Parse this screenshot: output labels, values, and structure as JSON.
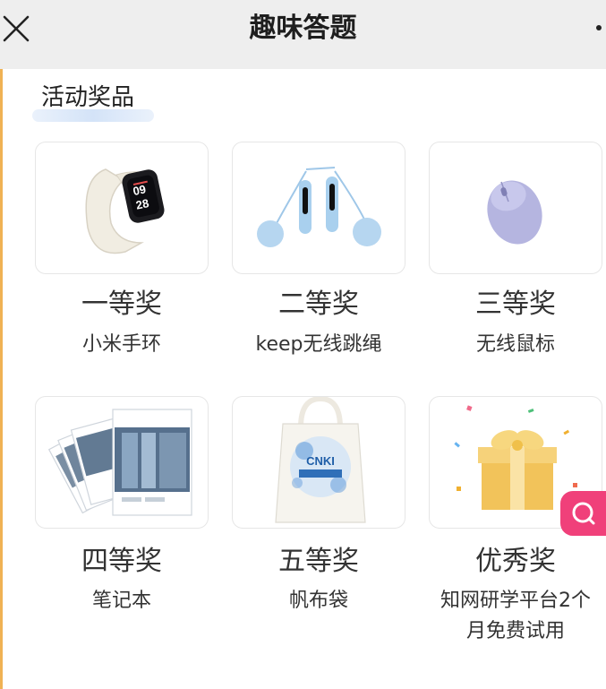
{
  "header": {
    "title": "趣味答题",
    "close_icon": "close-icon",
    "menu_icon": "more-dot-icon"
  },
  "section": {
    "title": "活动奖品"
  },
  "prizes": [
    {
      "rank": "一等奖",
      "name": "小米手环",
      "icon": "fitness-band-image"
    },
    {
      "rank": "二等奖",
      "name": "keep无线跳绳",
      "icon": "jump-rope-image"
    },
    {
      "rank": "三等奖",
      "name": "无线鼠标",
      "icon": "wireless-mouse-image"
    },
    {
      "rank": "四等奖",
      "name": "笔记本",
      "icon": "notebooks-image"
    },
    {
      "rank": "五等奖",
      "name": "帆布袋",
      "icon": "canvas-bag-image",
      "logo_text": "CNKI"
    },
    {
      "rank": "优秀奖",
      "name_line1": "知网研学平台2个",
      "name_line2": "月免费试用",
      "icon": "gift-box-image"
    }
  ],
  "colors": {
    "topbar": "#eeeeee",
    "accent_pink": "#f0407a",
    "left_edge": "#f0b254",
    "text": "#333333"
  },
  "floating_action": {
    "icon": "search-icon"
  }
}
